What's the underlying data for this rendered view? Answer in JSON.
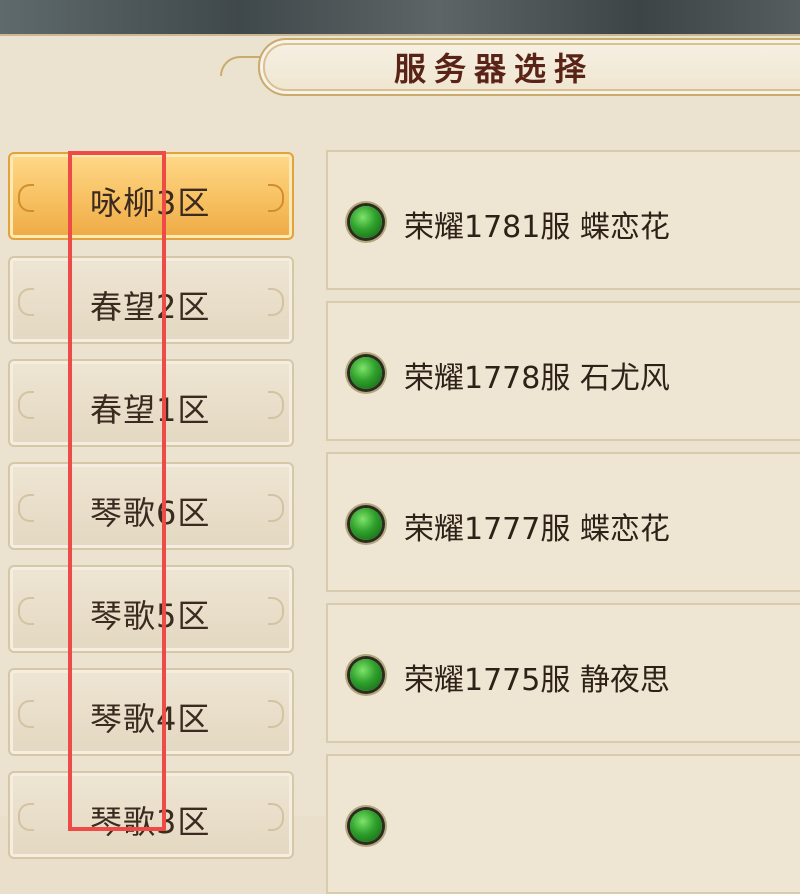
{
  "header": {
    "title": "服务器选择"
  },
  "zones": [
    {
      "label": "咏柳3区",
      "active": true
    },
    {
      "label": "春望2区",
      "active": false
    },
    {
      "label": "春望1区",
      "active": false
    },
    {
      "label": "琴歌6区",
      "active": false
    },
    {
      "label": "琴歌5区",
      "active": false
    },
    {
      "label": "琴歌4区",
      "active": false
    },
    {
      "label": "琴歌3区",
      "active": false
    }
  ],
  "servers": [
    {
      "label": "荣耀1781服 蝶恋花",
      "status": "online"
    },
    {
      "label": "荣耀1778服 石尤风",
      "status": "online"
    },
    {
      "label": "荣耀1777服 蝶恋花",
      "status": "online"
    },
    {
      "label": "荣耀1775服 静夜思",
      "status": "online"
    },
    {
      "label": "",
      "status": "online"
    }
  ],
  "colors": {
    "accent_active_tab": "#f7c061",
    "status_online": "#2fa12c",
    "highlight_frame": "#ee4a48"
  }
}
